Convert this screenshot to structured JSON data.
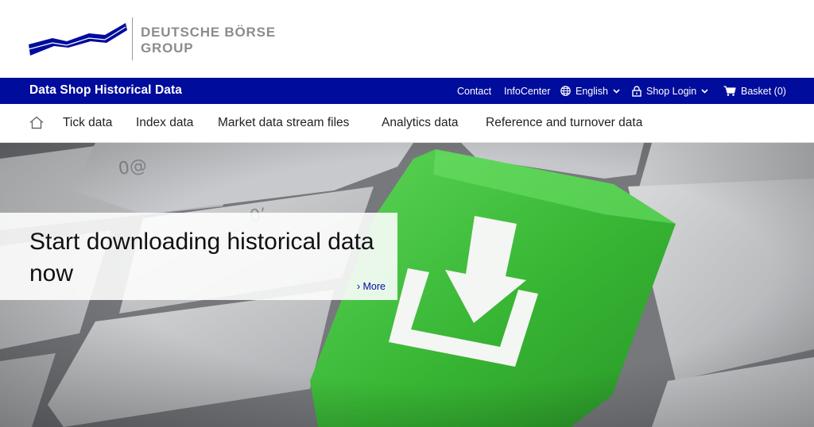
{
  "logo": {
    "line1": "DEUTSCHE BÖRSE",
    "line2": "GROUP",
    "mark_color": "#000c9c"
  },
  "topbar": {
    "title": "Data Shop Historical Data",
    "background": "#000c9c",
    "links": {
      "contact": "Contact",
      "infocenter": "InfoCenter",
      "language": "English",
      "shop_login": "Shop Login",
      "basket": "Basket (0)"
    },
    "icons": {
      "language": "globe-icon",
      "shop_login": "lock-icon",
      "basket": "cart-icon"
    }
  },
  "nav": {
    "home_icon": "home-icon",
    "items": [
      "Tick data",
      "Index data",
      "Market data stream files",
      "Analytics data",
      "Reference and turnover data"
    ]
  },
  "hero": {
    "title": "Start downloading historical data now",
    "more": "› More",
    "key_color": "#3fb73a"
  }
}
